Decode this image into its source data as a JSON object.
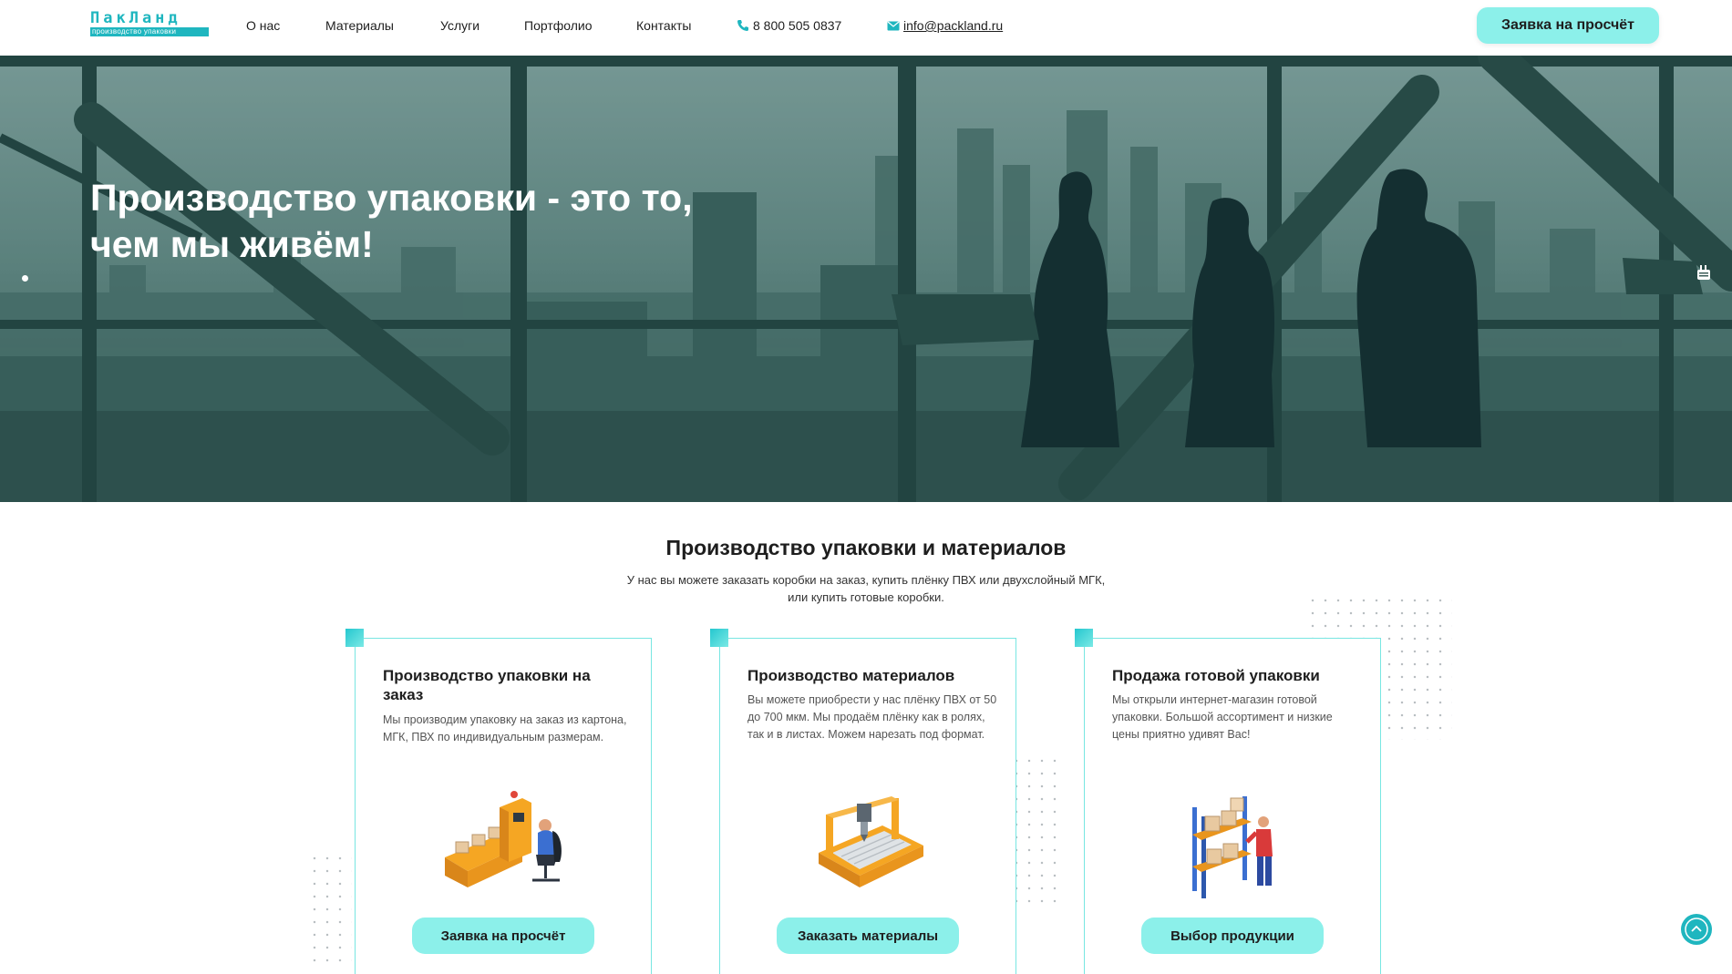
{
  "logo": {
    "title": "ПакЛанд",
    "subtitle": "производство упаковки"
  },
  "nav": {
    "items": [
      "О нас",
      "Материалы",
      "Услуги",
      "Портфолио",
      "Контакты"
    ]
  },
  "contacts": {
    "phone": "8 800 505 0837",
    "email": "info@packland.ru"
  },
  "header_cta": "Заявка на просчёт",
  "hero": {
    "title": "Производство упаковки - это то, чем мы живём!"
  },
  "section": {
    "title": "Производство упаковки и материалов",
    "subtitle_line1": "У нас вы можете заказать коробки на заказ, купить плёнку ПВХ или двухслойный МГК,",
    "subtitle_line2": "или купить готовые коробки."
  },
  "cards": [
    {
      "title": "Производство упаковки на заказ",
      "text": "Мы производим упаковку на заказ из картона, МГК, ПВХ по индивидуальным размерам.",
      "button": "Заявка на просчёт"
    },
    {
      "title": "Производство материалов",
      "text": "Вы можете приобрести у нас плёнку ПВХ от 50 до 700 мкм. Мы продаём плёнку как в ролях, так и в листах. Можем нарезать под формат.",
      "button": "Заказать материалы"
    },
    {
      "title": "Продажа готовой упаковки",
      "text": "Мы открыли интернет-магазин готовой упаковки. Большой ассортимент и низкие цены приятно удивят Вас!",
      "button": "Выбор продукции"
    }
  ],
  "colors": {
    "accent": "#8cf0ea",
    "brand": "#1fb6bf",
    "card_border": "#78e6e2"
  },
  "icons": [
    "phone-icon",
    "mail-icon",
    "youtube-icon",
    "arrow-up-icon"
  ]
}
